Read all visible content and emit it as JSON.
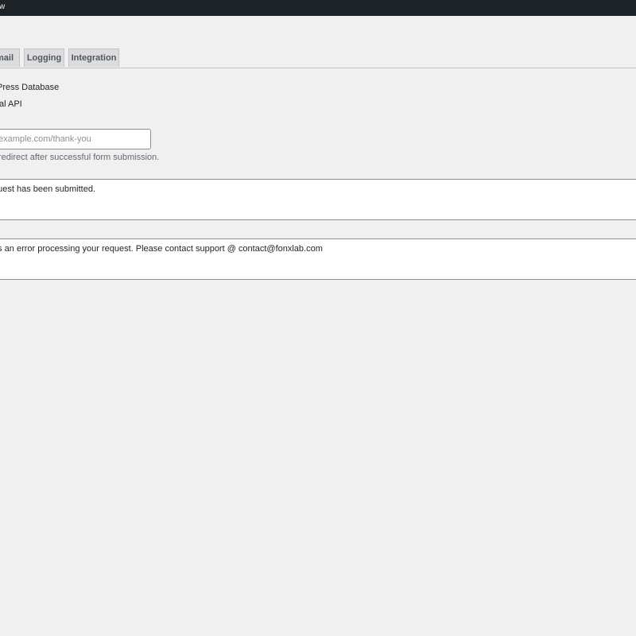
{
  "topbar": {
    "text": "w"
  },
  "tabs": [
    {
      "label": "mail"
    },
    {
      "label": "Logging"
    },
    {
      "label": "Integration"
    }
  ],
  "storage": {
    "option_wp_db": "Press Database",
    "option_api": "al API"
  },
  "redirect": {
    "placeholder": "example.com/thank-you",
    "value": "",
    "help": "redirect after successful form submission."
  },
  "messages": {
    "success": "quest has been submitted.",
    "error": "as an error processing your request. Please contact support @ contact@fonxlab.com"
  },
  "colors": {
    "topbar": "#1d2327",
    "background": "#f0f0f1",
    "tab_bg": "#dcdcde",
    "border": "#c3c4c7"
  }
}
